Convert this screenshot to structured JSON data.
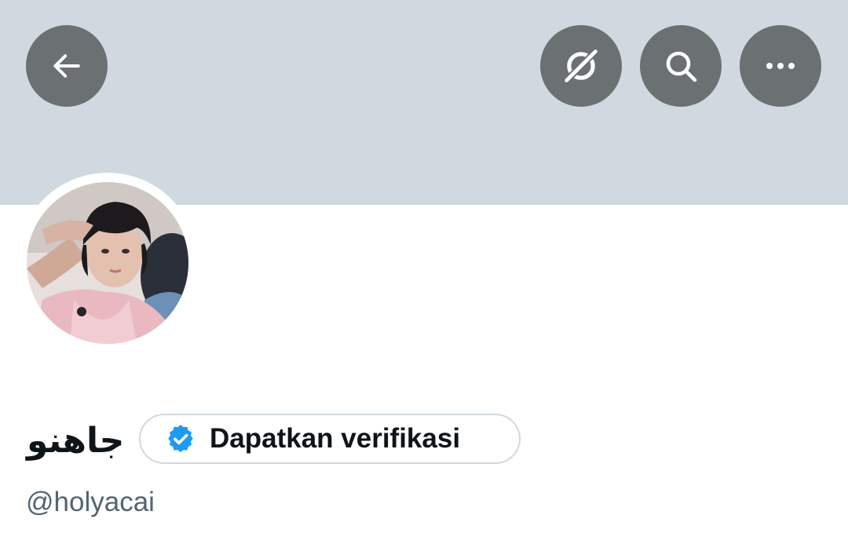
{
  "header": {
    "buttons": [
      {
        "icon": "back-arrow-icon"
      },
      {
        "icon": "grok-icon"
      },
      {
        "icon": "search-icon"
      },
      {
        "icon": "more-options-icon"
      }
    ],
    "banner_color": "#cfd9df",
    "button_color": "#6b7073"
  },
  "profile": {
    "avatar": {
      "description_icon": "profile-photo"
    },
    "display_name": "جاهنو",
    "verify_button": {
      "label": "Dapatkan verifikasi",
      "badge_icon": "verified-badge-icon",
      "badge_color": "#1d9bf0"
    },
    "handle": "@holyacai"
  }
}
